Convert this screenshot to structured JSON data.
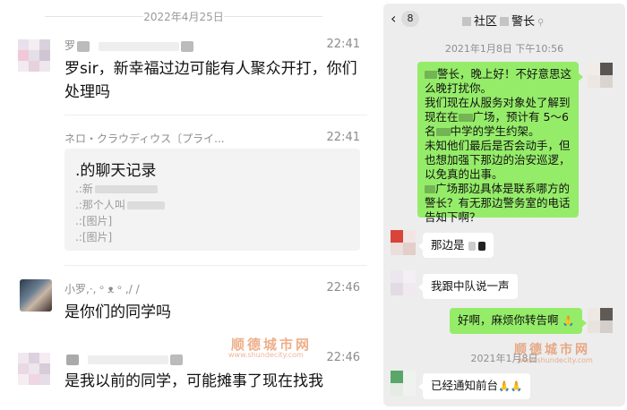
{
  "left_chat": {
    "date": "2022年4月25日",
    "messages": [
      {
        "sender": "罗",
        "time": "22:41",
        "text": "罗sir，新幸福过边可能有人聚众开打，你们处理吗"
      },
      {
        "sender": "ネロ・クラウディウス〔プライ...",
        "time": "22:41",
        "record": {
          "title": ".的聊天记录",
          "lines": [
            ".:新",
            ".:那个人叫",
            ".:[图片]",
            ".:[图片]"
          ]
        }
      },
      {
        "sender": "小罗,·, ᵒ ᴥ ᵒ ,/ /",
        "time": "22:46",
        "text": "是你们的同学吗"
      },
      {
        "sender": "",
        "time": "22:46",
        "text": "是我以前的同学，可能摊事了现在找我"
      }
    ],
    "watermark": {
      "brand": "顺德城市网",
      "url": "www.shundecity.com"
    }
  },
  "right_chat": {
    "header": {
      "back_count": "8",
      "title_a": "社区",
      "title_b": "警长"
    },
    "timestamp_1": "2021年1月8日 下午10:56",
    "outgoing_1": {
      "l1": "警长，晚上好！不好意思这么晚打扰你。",
      "l2a": "我们现在从服务对象处了解到现在在",
      "l2b": "广场，预计有 5～6名",
      "l2c": "中学的学生约架。",
      "l3": "未知他们最后是否会动手，但也想加强下那边的治安巡逻，以免真的出事。",
      "l4a": "广场那边具体是联系哪方的警长？有无那边警务室的电话告知下啊？"
    },
    "incoming_1": "那边是",
    "incoming_2": "我跟中队说一声",
    "outgoing_2": "好啊，麻烦你转告啊",
    "outgoing_2_emoji": "🙏",
    "timestamp_2": "2021年1月8日",
    "incoming_3": "已经通知前台",
    "incoming_3_emoji": "🙏🙏",
    "watermark": {
      "brand": "顺德城市网",
      "url": "www.shundecity.com"
    }
  },
  "colors": {
    "wechat_green": "#95ec69",
    "chat_bg": "#ededed",
    "watermark": "#e2783c"
  }
}
